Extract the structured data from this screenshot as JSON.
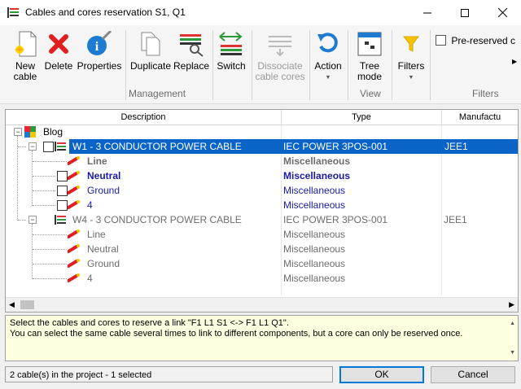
{
  "window": {
    "title": "Cables and cores reservation S1, Q1"
  },
  "ribbon": {
    "buttons": {
      "new_cable": "New\ncable",
      "delete": "Delete",
      "properties": "Properties",
      "duplicate": "Duplicate",
      "replace": "Replace",
      "switch": "Switch",
      "dissociate": "Dissociate\ncable cores",
      "action": "Action",
      "tree_mode": "Tree\nmode",
      "filters": "Filters",
      "pre_reserved": "Pre-reserved c"
    },
    "groups": {
      "management": "Management",
      "view": "View",
      "filters": "Filters"
    }
  },
  "grid": {
    "columns": [
      "Description",
      "Type",
      "Manufactu"
    ],
    "rows": [
      {
        "desc": "Blog",
        "type": "",
        "manu": ""
      },
      {
        "desc": "W1 - 3 CONDUCTOR POWER CABLE",
        "type": "IEC POWER 3POS-001",
        "manu": "JEE1"
      },
      {
        "desc": "Line",
        "type": "Miscellaneous",
        "manu": ""
      },
      {
        "desc": "Neutral",
        "type": "Miscellaneous",
        "manu": ""
      },
      {
        "desc": "Ground",
        "type": "Miscellaneous",
        "manu": ""
      },
      {
        "desc": "4",
        "type": "Miscellaneous",
        "manu": ""
      },
      {
        "desc": "W4 - 3 CONDUCTOR POWER CABLE",
        "type": "IEC POWER 3POS-001",
        "manu": "JEE1"
      },
      {
        "desc": "Line",
        "type": "Miscellaneous",
        "manu": ""
      },
      {
        "desc": "Neutral",
        "type": "Miscellaneous",
        "manu": ""
      },
      {
        "desc": "Ground",
        "type": "Miscellaneous",
        "manu": ""
      },
      {
        "desc": "4",
        "type": "Miscellaneous",
        "manu": ""
      }
    ]
  },
  "message": {
    "line1": "Select the cables and cores to reserve a link \"F1 L1 S1 <-> F1 L1 Q1\".",
    "line2": "You can select the same cable several times to link to different components, but a core can only be reserved once."
  },
  "status": "2 cable(s) in the project - 1 selected",
  "buttons": {
    "ok": "OK",
    "cancel": "Cancel"
  },
  "colors": {
    "selection": "#0a64c8",
    "link_blue": "#1a1aa8",
    "info_bg": "#ffffe1"
  }
}
